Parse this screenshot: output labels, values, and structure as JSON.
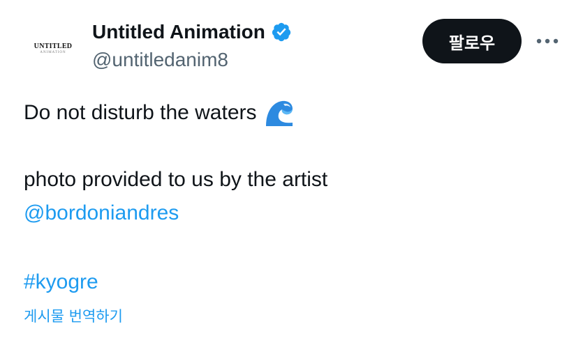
{
  "author": {
    "avatar_text": "UNTITLED",
    "avatar_subtext": "ANIMATION",
    "display_name": "Untitled Animation",
    "handle": "@untitledanim8",
    "verified_icon": "verified-badge-icon"
  },
  "actions": {
    "follow_label": "팔로우",
    "more_icon": "more-options-icon"
  },
  "post": {
    "line1": "Do not disturb the waters",
    "line1_emoji": "wave-emoji",
    "line2": "photo provided to us by the artist",
    "mention": "@bordoniandres",
    "hashtag": "#kyogre",
    "translate_label": "게시물 번역하기"
  },
  "colors": {
    "link": "#1d9bf0",
    "text": "#0f1419",
    "secondary": "#536471",
    "follow_bg": "#0f1419"
  }
}
